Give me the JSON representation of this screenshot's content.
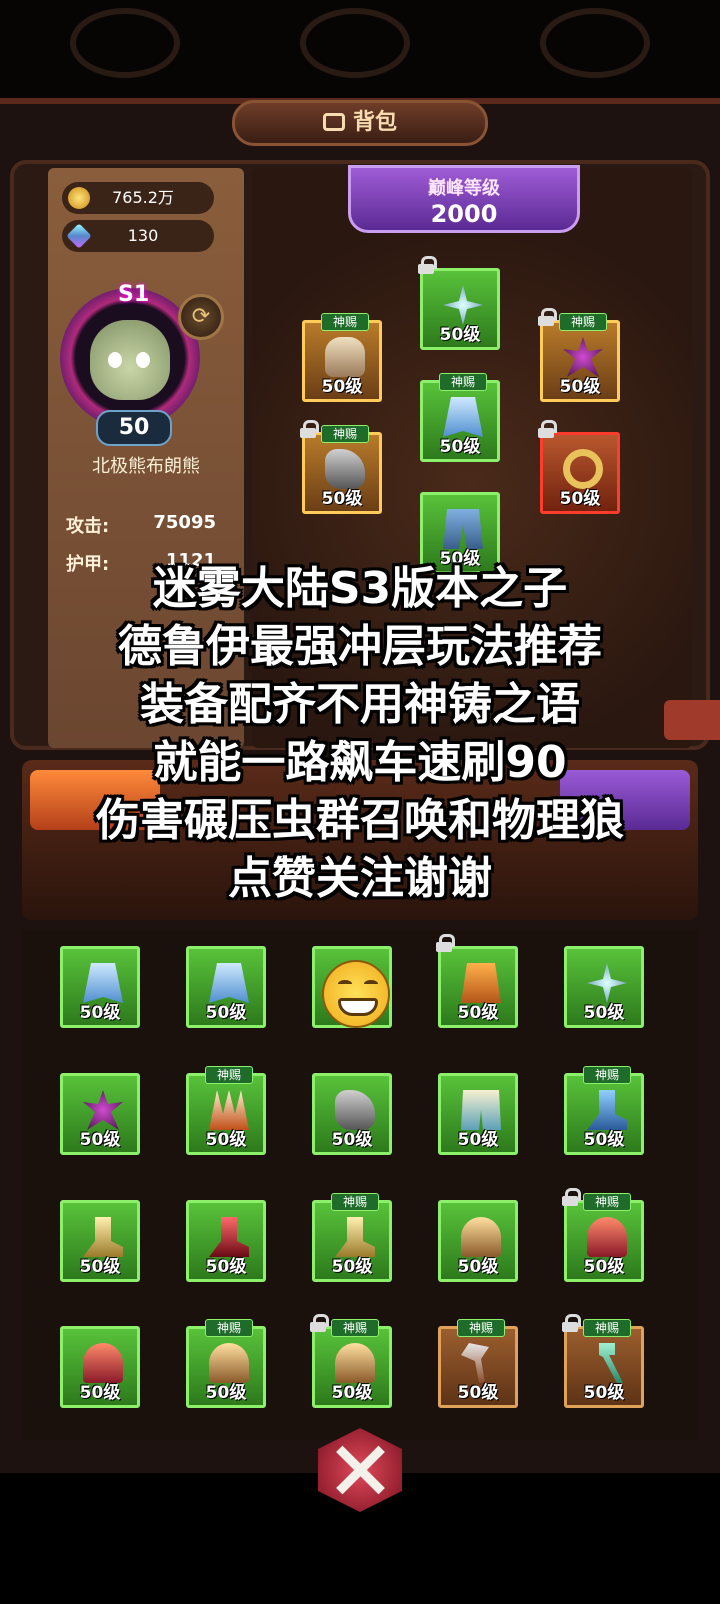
{
  "header": {
    "title": "背包"
  },
  "currency": {
    "gold": "765.2万",
    "gems": "130"
  },
  "hero": {
    "season": "S1",
    "level": "50",
    "name": "北极熊布朗熊",
    "stats": [
      {
        "label": "攻击:",
        "value": "75095"
      },
      {
        "label": "护甲:",
        "value": "1121"
      }
    ]
  },
  "peak": {
    "label": "巅峰等级",
    "value": "2000"
  },
  "equipped": [
    {
      "frame": "green",
      "icon": "star-blade-icon",
      "level": "50级",
      "gift": "",
      "locked": true
    },
    {
      "frame": "gold",
      "icon": "chest-armor-icon",
      "level": "50级",
      "gift": "神赐",
      "locked": false
    },
    {
      "frame": "gold",
      "icon": "dark-collar-icon",
      "level": "50级",
      "gift": "神赐",
      "locked": true
    },
    {
      "frame": "green",
      "icon": "cloak-icon",
      "level": "50级",
      "gift": "神赐",
      "locked": false
    },
    {
      "frame": "gold",
      "icon": "gauntlet-icon",
      "level": "50级",
      "gift": "神赐",
      "locked": true
    },
    {
      "frame": "red",
      "icon": "ring-icon",
      "level": "50级",
      "gift": "",
      "locked": true
    },
    {
      "frame": "green",
      "icon": "pants-icon",
      "level": "50级",
      "gift": "",
      "locked": false
    }
  ],
  "caption": {
    "lines": [
      "迷雾大陆S3版本之子",
      "德鲁伊最强冲层玩法推荐",
      "装备配齐不用神铸之语",
      "就能一路飙车速刷90",
      "伤害碾压虫群召唤和物理狼",
      "点赞关注谢谢"
    ]
  },
  "inventory": [
    {
      "frame": "green",
      "icon": "cloak-icon",
      "level": "50级",
      "gift": "",
      "locked": false
    },
    {
      "frame": "green",
      "icon": "cloak-icon",
      "level": "50级",
      "gift": "",
      "locked": false
    },
    {
      "frame": "green",
      "icon": "shield-icon",
      "level": "50级",
      "gift": "",
      "locked": false
    },
    {
      "frame": "green",
      "icon": "orange-armor-icon",
      "level": "50级",
      "gift": "",
      "locked": true
    },
    {
      "frame": "green",
      "icon": "star-blade-icon",
      "level": "50级",
      "gift": "",
      "locked": false
    },
    {
      "frame": "green",
      "icon": "spiked-amulet-icon",
      "level": "50级",
      "gift": "",
      "locked": false
    },
    {
      "frame": "green",
      "icon": "claw-icon",
      "level": "50级",
      "gift": "神赐",
      "locked": false
    },
    {
      "frame": "green",
      "icon": "gauntlet-icon",
      "level": "50级",
      "gift": "",
      "locked": false
    },
    {
      "frame": "green",
      "icon": "shorts-icon",
      "level": "50级",
      "gift": "",
      "locked": false
    },
    {
      "frame": "green",
      "icon": "boots-icon",
      "level": "50级",
      "gift": "神赐",
      "locked": false
    },
    {
      "frame": "green",
      "icon": "gold-boots-icon",
      "level": "50级",
      "gift": "",
      "locked": false
    },
    {
      "frame": "green",
      "icon": "red-boots-icon",
      "level": "50级",
      "gift": "",
      "locked": false
    },
    {
      "frame": "green",
      "icon": "sandals-icon",
      "level": "50级",
      "gift": "神赐",
      "locked": false
    },
    {
      "frame": "green",
      "icon": "helmet-icon",
      "level": "50级",
      "gift": "",
      "locked": false
    },
    {
      "frame": "green",
      "icon": "red-helmet-icon",
      "level": "50级",
      "gift": "神赐",
      "locked": true
    },
    {
      "frame": "green",
      "icon": "red-helmet-icon",
      "level": "50级",
      "gift": "",
      "locked": false
    },
    {
      "frame": "green",
      "icon": "helmet-icon",
      "level": "50级",
      "gift": "神赐",
      "locked": false
    },
    {
      "frame": "green",
      "icon": "bronze-helmet-icon",
      "level": "50级",
      "gift": "神赐",
      "locked": true
    },
    {
      "frame": "brown",
      "icon": "axe-icon",
      "level": "50级",
      "gift": "神赐",
      "locked": false
    },
    {
      "frame": "brown",
      "icon": "staff-icon",
      "level": "50级",
      "gift": "神赐",
      "locked": true
    }
  ]
}
